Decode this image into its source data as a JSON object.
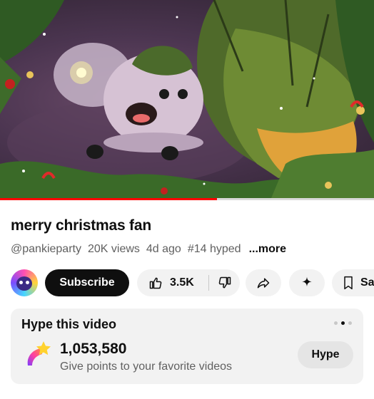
{
  "video": {
    "progress_fraction": 0.58,
    "colors": {
      "progress": "#ff0000"
    }
  },
  "title": "merry christmas fan",
  "meta": {
    "channel_handle": "@pankieparty",
    "views": "20K views",
    "age": "4d ago",
    "hype_rank": "#14 hyped",
    "more_label": "...more"
  },
  "actions": {
    "subscribe_label": "Subscribe",
    "like_count": "3.5K",
    "save_label": "Sa"
  },
  "icons": {
    "avatar": "channel-avatar",
    "like": "thumbs-up-icon",
    "dislike": "thumbs-down-icon",
    "share": "share-arrow-icon",
    "sparkle": "sparkle-icon",
    "save": "bookmark-icon",
    "hype": "shooting-star-icon"
  },
  "hype_card": {
    "title": "Hype this video",
    "count": "1,053,580",
    "subtitle": "Give points to your favorite videos",
    "button_label": "Hype",
    "carousel_page": 2,
    "carousel_total": 3
  }
}
